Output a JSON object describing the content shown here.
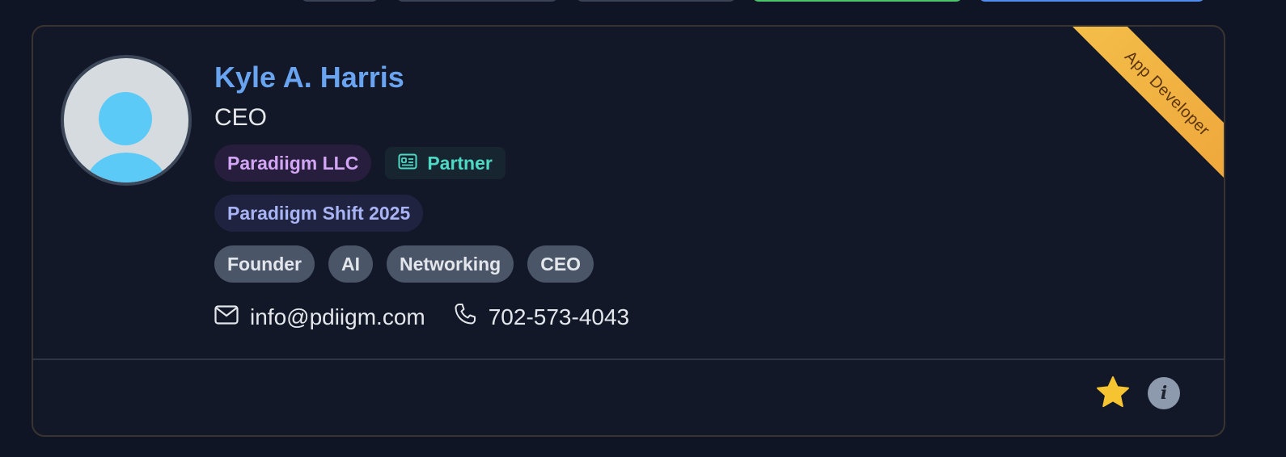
{
  "profile": {
    "name": "Kyle A. Harris",
    "title": "CEO",
    "ribbon": "App Developer",
    "company": "Paradiigm LLC",
    "role_badge": "Partner",
    "event": "Paradiigm Shift 2025",
    "tags": [
      "Founder",
      "AI",
      "Networking",
      "CEO"
    ],
    "email": "info@pdiigm.com",
    "phone": "702-573-4043"
  },
  "icons": {
    "avatar": "user-avatar-icon",
    "partner": "id-card-icon",
    "email": "envelope-icon",
    "phone": "phone-icon",
    "favorite": "star-icon",
    "info": "info-icon"
  },
  "colors": {
    "name": "#69a4f1",
    "ribbon": "#f0b040",
    "star": "#f6c431",
    "partner": "#4fd9c4"
  }
}
